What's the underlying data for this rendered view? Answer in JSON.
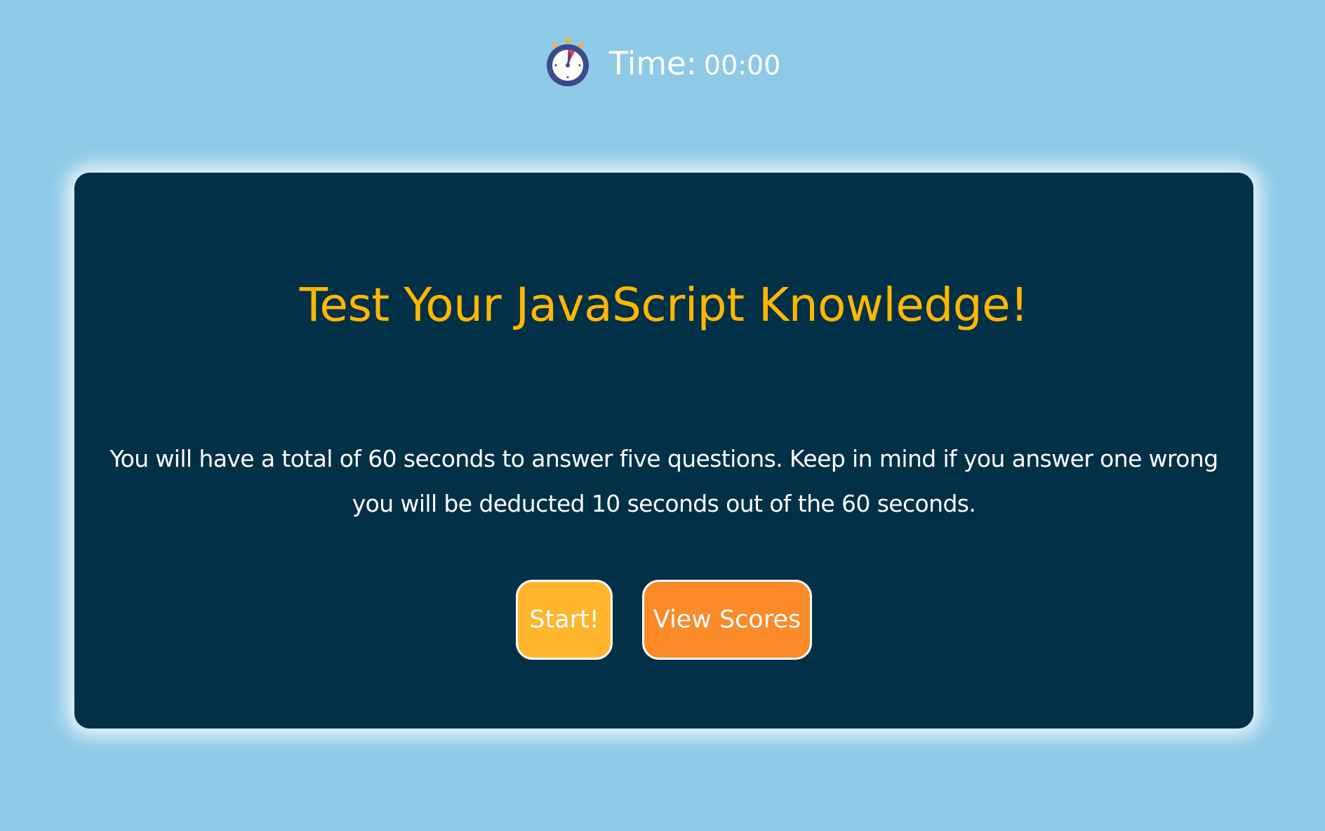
{
  "timer": {
    "icon": "stopwatch-icon",
    "label": "Time:",
    "value": "00:00"
  },
  "quiz": {
    "title": "Test Your JavaScript Knowledge!",
    "description": "You will have a total of 60 seconds to answer five questions. Keep in mind if you answer one wrong you will be deducted 10 seconds out of the 60 seconds."
  },
  "buttons": {
    "start_label": "Start!",
    "scores_label": "View Scores"
  },
  "colors": {
    "background": "#8ecae6",
    "card": "#023047",
    "title": "#ffb703",
    "start_button": "#ffb62e",
    "scores_button": "#fb8a29"
  }
}
